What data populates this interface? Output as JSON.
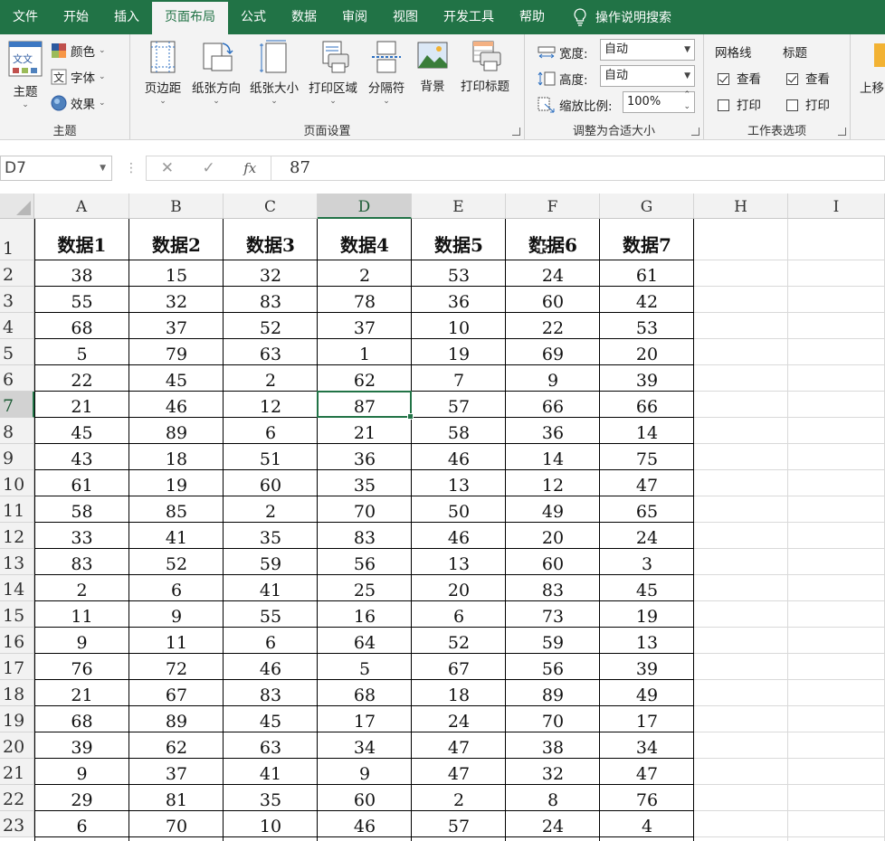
{
  "tabs": [
    {
      "label": "文件",
      "active": false
    },
    {
      "label": "开始",
      "active": false
    },
    {
      "label": "插入",
      "active": false
    },
    {
      "label": "页面布局",
      "active": true
    },
    {
      "label": "公式",
      "active": false
    },
    {
      "label": "数据",
      "active": false
    },
    {
      "label": "审阅",
      "active": false
    },
    {
      "label": "视图",
      "active": false
    },
    {
      "label": "开发工具",
      "active": false
    },
    {
      "label": "帮助",
      "active": false
    }
  ],
  "tell_me": "操作说明搜索",
  "ribbon": {
    "theme_group": {
      "title": "主题",
      "theme_btn": "主题",
      "colors": "颜色",
      "fonts": "字体",
      "effects": "效果",
      "theme_icon_text": "文文"
    },
    "page_setup_group": {
      "title": "页面设置",
      "buttons": [
        "页边距",
        "纸张方向",
        "纸张大小",
        "打印区域",
        "分隔符",
        "背景",
        "打印标题"
      ]
    },
    "scale_group": {
      "title": "调整为合适大小",
      "width_label": "宽度:",
      "width_value": "自动",
      "height_label": "高度:",
      "height_value": "自动",
      "scale_label": "缩放比例:",
      "scale_value": "100%"
    },
    "sheet_options_group": {
      "title": "工作表选项",
      "gridlines_label": "网格线",
      "headings_label": "标题",
      "view_label": "查看",
      "print_label": "打印",
      "gridlines_view": true,
      "gridlines_print": false,
      "headings_view": true,
      "headings_print": false
    },
    "arrange_partial": "上移"
  },
  "formula_bar": {
    "name_box": "D7",
    "fx": "fx",
    "value": "87"
  },
  "columns": [
    "A",
    "B",
    "C",
    "D",
    "E",
    "F",
    "G",
    "H",
    "I"
  ],
  "selected_cell": {
    "col": 3,
    "row": 6
  },
  "header_row": [
    "数据1",
    "数据2",
    "数据3",
    "数据4",
    "数据5",
    "数据6",
    "数据7"
  ],
  "rows": [
    [
      38,
      15,
      32,
      2,
      53,
      24,
      61
    ],
    [
      55,
      32,
      83,
      78,
      36,
      60,
      42
    ],
    [
      68,
      37,
      52,
      37,
      10,
      22,
      53
    ],
    [
      5,
      79,
      63,
      1,
      19,
      69,
      20
    ],
    [
      22,
      45,
      2,
      62,
      7,
      9,
      39
    ],
    [
      21,
      46,
      12,
      87,
      57,
      66,
      66
    ],
    [
      45,
      89,
      6,
      21,
      58,
      36,
      14
    ],
    [
      43,
      18,
      51,
      36,
      46,
      14,
      75
    ],
    [
      61,
      19,
      60,
      35,
      13,
      12,
      47
    ],
    [
      58,
      85,
      2,
      70,
      50,
      49,
      65
    ],
    [
      33,
      41,
      35,
      83,
      46,
      20,
      24
    ],
    [
      83,
      52,
      59,
      56,
      13,
      60,
      3
    ],
    [
      2,
      6,
      41,
      25,
      20,
      83,
      45
    ],
    [
      11,
      9,
      55,
      16,
      6,
      73,
      19
    ],
    [
      9,
      11,
      6,
      64,
      52,
      59,
      13
    ],
    [
      76,
      72,
      46,
      5,
      67,
      56,
      39
    ],
    [
      21,
      67,
      83,
      68,
      18,
      89,
      49
    ],
    [
      68,
      89,
      45,
      17,
      24,
      70,
      17
    ],
    [
      39,
      62,
      63,
      34,
      47,
      38,
      34
    ],
    [
      9,
      37,
      41,
      9,
      47,
      32,
      47
    ],
    [
      29,
      81,
      35,
      60,
      2,
      8,
      76
    ],
    [
      6,
      70,
      10,
      46,
      57,
      24,
      4
    ]
  ],
  "colors": {
    "accent": "#217346",
    "ribbon_bg": "#f3f3f3"
  }
}
